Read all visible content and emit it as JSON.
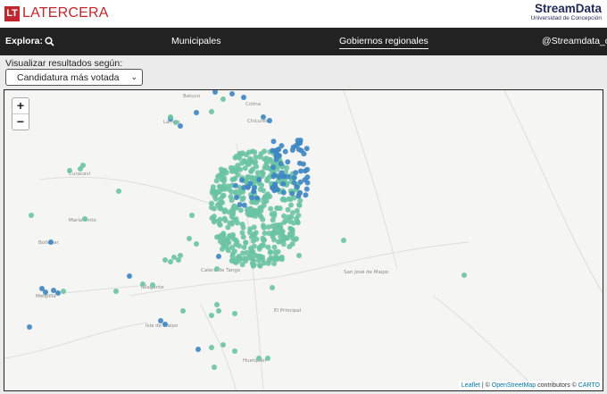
{
  "header": {
    "logo_mark": "LT",
    "logo_text": "LATERCERA",
    "partner_title": "StreamData",
    "partner_subtitle": "Universidad de Concepción"
  },
  "nav": {
    "explora": "Explora:",
    "items": [
      "Municipales",
      "Gobiernos regionales"
    ],
    "active": "Gobiernos regionales",
    "handle": "@Streamdata_cl"
  },
  "controls": {
    "label": "Visualizar resultados según:",
    "selected": "Candidatura más votada",
    "caret": "⌄"
  },
  "map": {
    "zoom_in": "+",
    "zoom_out": "−",
    "attribution": {
      "leaflet": "Leaflet",
      "sep": " | © ",
      "osm": "OpenStreetMap",
      "contributors": " contributors © ",
      "carto": "CARTO"
    },
    "places": [
      "Batuco",
      "Lampa",
      "Colina",
      "Chicureo",
      "Curacaví",
      "María Pinto",
      "Bollenar",
      "Melipilla",
      "Talagante",
      "Calera de Tango",
      "El Principal",
      "Isla de Maipo",
      "Huelquén",
      "San José de Maipo"
    ],
    "point_colors": {
      "green": "#6ac3a4",
      "blue": "#3d86c2"
    }
  }
}
